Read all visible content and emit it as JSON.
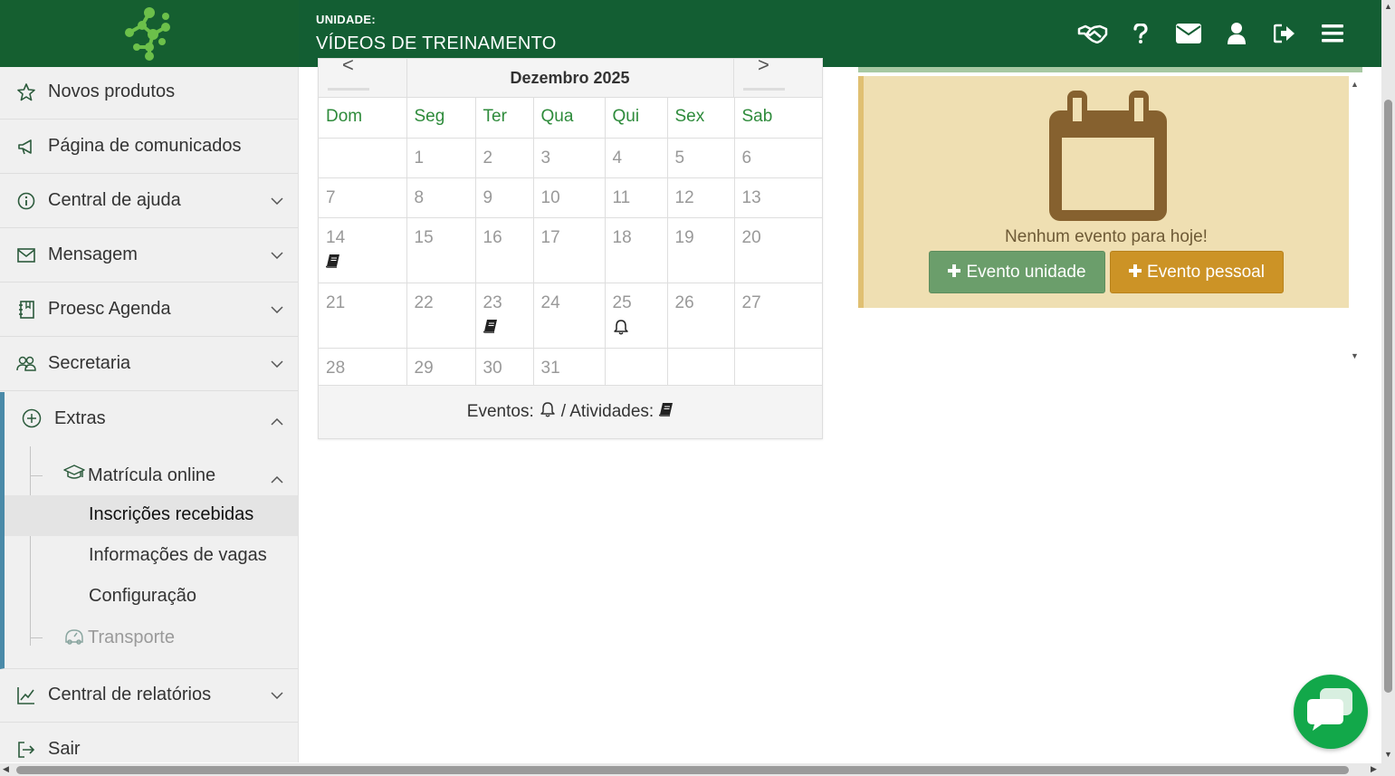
{
  "header": {
    "unit_label": "UNIDADE:",
    "unit_name": "VÍDEOS DE TREINAMENTO",
    "icons": [
      "handshake-icon",
      "help-icon",
      "mail-icon",
      "user-icon",
      "logout-icon",
      "menu-icon"
    ],
    "bg_color": "#135e33"
  },
  "sidebar": {
    "items": [
      {
        "label": "Novos produtos",
        "icon": "star-icon"
      },
      {
        "label": "Página de comunicados",
        "icon": "megaphone-icon"
      },
      {
        "label": "Central de ajuda",
        "icon": "info-icon"
      },
      {
        "label": "Mensagem",
        "icon": "envelope-icon"
      },
      {
        "label": "Proesc Agenda",
        "icon": "agenda-icon"
      },
      {
        "label": "Secretaria",
        "icon": "people-icon"
      }
    ],
    "extras": {
      "label": "Extras",
      "matricula": {
        "label": "Matrícula online",
        "children": [
          "Inscrições recebidas",
          "Informações de vagas",
          "Configuração"
        ],
        "active": "Inscrições recebidas"
      },
      "transporte": "Transporte"
    },
    "bottom_items": [
      {
        "label": "Central de relatórios",
        "icon": "chart-icon"
      },
      {
        "label": "Sair",
        "icon": "exit-icon"
      }
    ],
    "accent_color": "#4a8aa8"
  },
  "calendar": {
    "prev": "<",
    "next": ">",
    "month": "Dezembro 2025",
    "weekdays": [
      "Dom",
      "Seg",
      "Ter",
      "Qua",
      "Qui",
      "Sex",
      "Sab"
    ],
    "weeks": [
      [
        "",
        "1",
        "2",
        "3",
        "4",
        "5",
        "6"
      ],
      [
        "7",
        "8",
        "9",
        "10",
        "11",
        "12",
        "13"
      ],
      [
        "14",
        "15",
        "16",
        "17",
        "18",
        "19",
        "20"
      ],
      [
        "21",
        "22",
        "23",
        "24",
        "25",
        "26",
        "27"
      ],
      [
        "28",
        "29",
        "30",
        "31",
        "",
        "",
        ""
      ]
    ],
    "markers": {
      "14": "activity",
      "23": "activity",
      "25": "event"
    },
    "legend_events": "Eventos:",
    "legend_sep": "/ Atividades:"
  },
  "today_panel": {
    "message": "Nenhum evento para hoje!",
    "btn_unit": "Evento unidade",
    "btn_personal": "Evento pessoal",
    "icon": "calendar-icon"
  }
}
